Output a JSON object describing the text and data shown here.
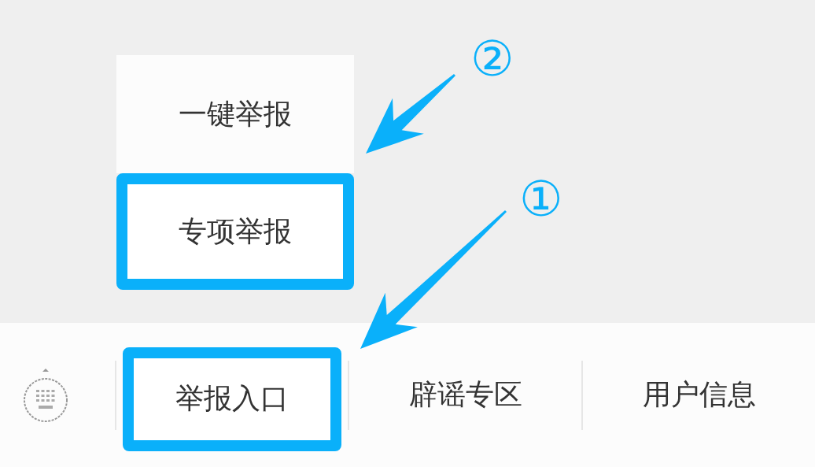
{
  "submenu": {
    "items": [
      {
        "label": "一键举报",
        "highlighted": false
      },
      {
        "label": "专项举报",
        "highlighted": true
      }
    ]
  },
  "menu_bar": {
    "items": [
      {
        "label": "举报入口",
        "highlighted": true
      },
      {
        "label": "辟谣专区",
        "highlighted": false
      },
      {
        "label": "用户信息",
        "highlighted": false
      }
    ]
  },
  "annotations": [
    {
      "number": "①"
    },
    {
      "number": "②"
    }
  ]
}
